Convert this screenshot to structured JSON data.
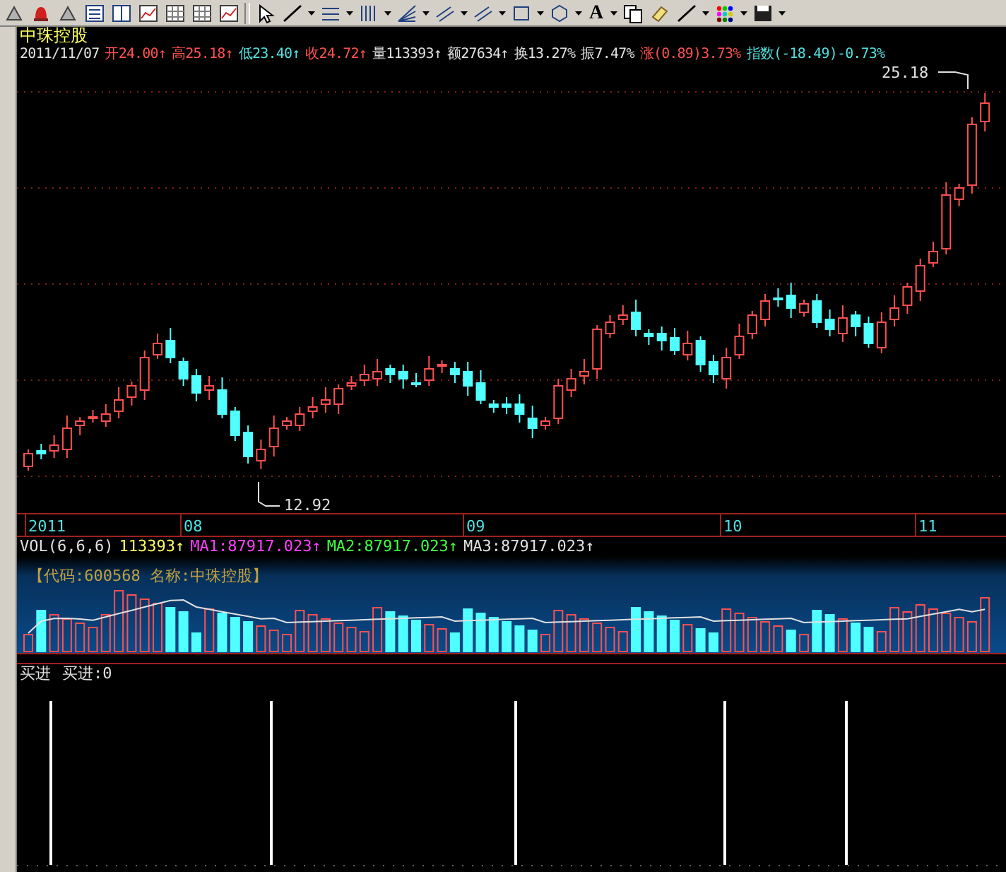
{
  "toolbar": {
    "text_tool": "A"
  },
  "stock_name": "中珠控股",
  "quote": {
    "date": "2011/11/07",
    "items": [
      {
        "text": "开24.00↑",
        "color": "#ff5050"
      },
      {
        "text": "高25.18↑",
        "color": "#ff5050"
      },
      {
        "text": "低23.40↑",
        "color": "#50e0e0"
      },
      {
        "text": "收24.72↑",
        "color": "#ff5050"
      },
      {
        "text": "量113393↑",
        "color": "#e0e0e0"
      },
      {
        "text": "额27634↑",
        "color": "#e0e0e0"
      },
      {
        "text": "换13.27%",
        "color": "#e0e0e0"
      },
      {
        "text": "振7.47%",
        "color": "#e0e0e0"
      },
      {
        "text": "涨(0.89)3.73%",
        "color": "#ff5050"
      },
      {
        "text": "指数(-18.49)-0.73%",
        "color": "#50e0e0"
      }
    ]
  },
  "price_labels": {
    "high": "25.18",
    "low": "12.92"
  },
  "x_axis": [
    "2011",
    "08",
    "09",
    "10",
    "11"
  ],
  "volume": {
    "title": "VOL(6,6,6)",
    "items": [
      {
        "text": "113393↑",
        "color": "#ffff60"
      },
      {
        "text": "MA1:87917.023↑",
        "color": "#ff40ff"
      },
      {
        "text": "MA2:87917.023↑",
        "color": "#40ff40"
      },
      {
        "text": "MA3:87917.023↑",
        "color": "#e0e0e0"
      }
    ],
    "info": "【代码:600568 名称:中珠控股】"
  },
  "signal_panel": {
    "title": "买进",
    "value": "买进:0"
  }
}
